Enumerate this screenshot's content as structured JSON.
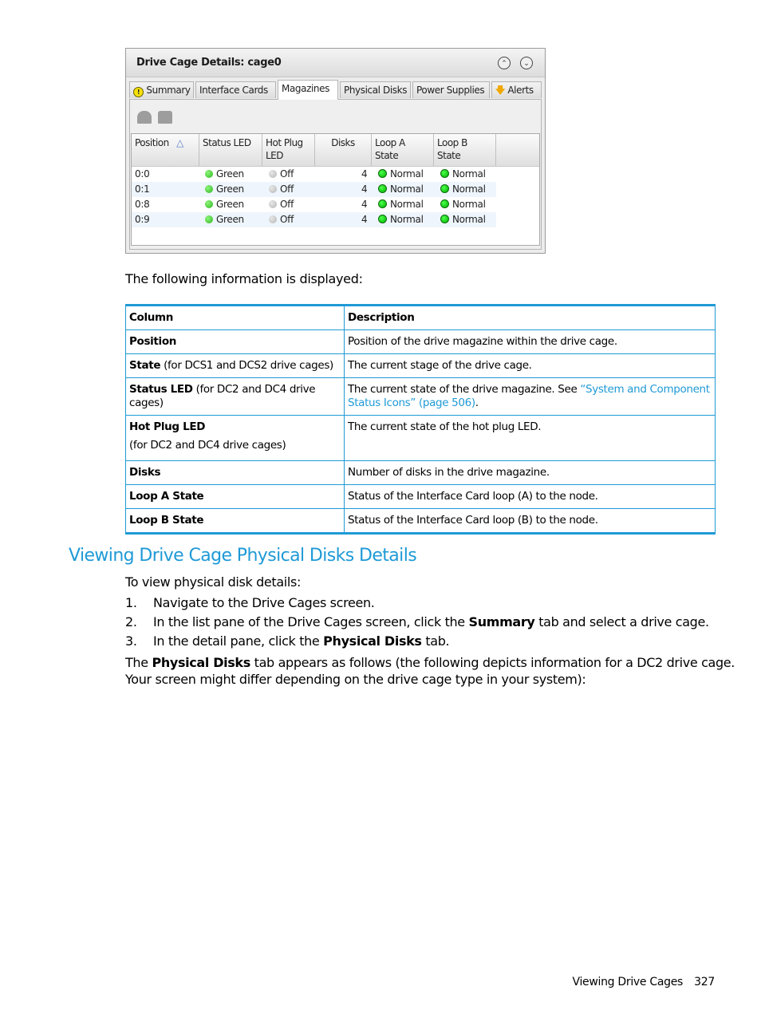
{
  "screenshot": {
    "title": "Drive Cage Details: cage0",
    "controls": {
      "collapse": "collapse-up-icon",
      "expand": "expand-down-icon"
    },
    "tabs": [
      {
        "label": "Summary",
        "icon": "warning-icon",
        "active": false
      },
      {
        "label": "Interface Cards",
        "active": false
      },
      {
        "label": "Magazines",
        "active": true
      },
      {
        "label": "Physical Disks",
        "active": false
      },
      {
        "label": "Power Supplies",
        "active": false
      },
      {
        "label": "Alerts",
        "icon": "alert-arrow-icon",
        "active": false
      }
    ],
    "toolbar_icons": [
      "magazine-locate-icon",
      "magazine-icon"
    ],
    "columns": [
      "Position",
      "Status LED",
      "Hot Plug LED",
      "Disks",
      "Loop A State",
      "Loop B State"
    ],
    "column_lines": [
      [
        "Position"
      ],
      [
        "Status LED"
      ],
      [
        "Hot Plug",
        "LED"
      ],
      [
        "Disks"
      ],
      [
        "Loop A",
        "State"
      ],
      [
        "Loop B",
        "State"
      ]
    ],
    "sort": {
      "column": "Position",
      "direction": "ascending"
    },
    "rows": [
      {
        "position": "0:0",
        "status_led": "Green",
        "hot_plug_led": "Off",
        "disks": "4",
        "loop_a": "Normal",
        "loop_b": "Normal"
      },
      {
        "position": "0:1",
        "status_led": "Green",
        "hot_plug_led": "Off",
        "disks": "4",
        "loop_a": "Normal",
        "loop_b": "Normal"
      },
      {
        "position": "0:8",
        "status_led": "Green",
        "hot_plug_led": "Off",
        "disks": "4",
        "loop_a": "Normal",
        "loop_b": "Normal"
      },
      {
        "position": "0:9",
        "status_led": "Green",
        "hot_plug_led": "Off",
        "disks": "4",
        "loop_a": "Normal",
        "loop_b": "Normal"
      }
    ]
  },
  "intro": "The following information is displayed:",
  "info_table": {
    "headers": [
      "Column",
      "Description"
    ],
    "rows": [
      {
        "name": "Position",
        "qualifier": "",
        "description": "Position of the drive magazine within the drive cage.",
        "link": ""
      },
      {
        "name": "State",
        "qualifier": " (for DCS1 and DCS2 drive cages)",
        "description": "The current stage of the drive cage.",
        "link": ""
      },
      {
        "name": "Status LED",
        "qualifier": " (for DC2 and DC4 drive cages)",
        "description": "The current state of the drive magazine. See ",
        "link": "“System and Component Status Icons” (page 506)",
        "after_link": "."
      },
      {
        "name": "Hot Plug LED",
        "qualifier_line2": "(for DC2 and DC4 drive cages)",
        "description": "The current state of the hot plug LED.",
        "link": ""
      },
      {
        "name": "Disks",
        "qualifier": "",
        "description": "Number of disks in the drive magazine.",
        "link": ""
      },
      {
        "name": "Loop A State",
        "qualifier": "",
        "description": "Status of the Interface Card loop (A) to the node.",
        "link": ""
      },
      {
        "name": "Loop B State",
        "qualifier": "",
        "description": "Status of the Interface Card loop (B) to the node.",
        "link": ""
      }
    ]
  },
  "section": {
    "heading": "Viewing Drive Cage Physical Disks Details",
    "lead": "To view physical disk details:",
    "steps": [
      {
        "num": "1.",
        "pre": "Navigate to the Drive Cages screen.",
        "bold": "",
        "post": ""
      },
      {
        "num": "2.",
        "pre": "In the list pane of the Drive Cages screen, click the ",
        "bold": "Summary",
        "post": " tab and select a drive cage."
      },
      {
        "num": "3.",
        "pre": "In the detail pane, click the ",
        "bold": "Physical Disks",
        "post": " tab."
      }
    ],
    "para_pre": "The ",
    "para_bold": "Physical Disks",
    "para_line1": " tab appears as follows (the following depicts information for a DC2 drive cage.",
    "para_line2": "Your screen might differ depending on the drive cage type in your system):"
  },
  "footer": {
    "section": "Viewing Drive Cages",
    "page": "327"
  },
  "colors": {
    "accent": "#1f9ad6",
    "status_green": "#2eb51d",
    "led_off": "#b4b4b4"
  }
}
